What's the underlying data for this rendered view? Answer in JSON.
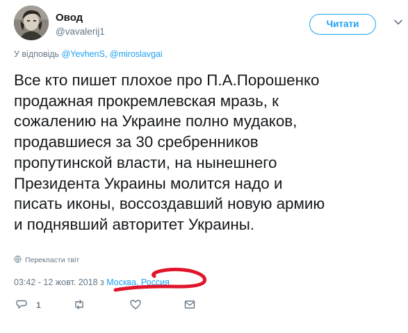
{
  "header": {
    "display_name": "Овод",
    "handle": "@vavalerij1",
    "follow_label": "Читати"
  },
  "reply": {
    "prefix": "У відповідь",
    "mentions": [
      "@YevhenS",
      "@miroslavgai"
    ],
    "separator": ", "
  },
  "tweet": {
    "text": "Все кто пишет плохое про П.А.Порошенко\nпродажная прокремлевская мразь, к\nсожалению на Украине полно мудаков,\nпродавшиеся за 30 сребренников\nпропутинской власти, на нынешнего\nПрезидента Украины молится надо и\nписать иконы, воссоздавший новую армию\nи поднявший авторитет Украины."
  },
  "translate": {
    "label": "Перекласти твіт",
    "icon": "globe-icon"
  },
  "meta": {
    "datetime": "03:42 - 12 жовт. 2018",
    "location_prefix": " з ",
    "location": "Москва, Россия"
  },
  "actions": {
    "reply_count": "1",
    "icons": [
      "reply-icon",
      "retweet-icon",
      "like-icon",
      "message-icon"
    ]
  },
  "colors": {
    "accent": "#1da1f2",
    "secondary_text": "#657786",
    "primary_text": "#14171a",
    "annotation": "#e0142a"
  }
}
